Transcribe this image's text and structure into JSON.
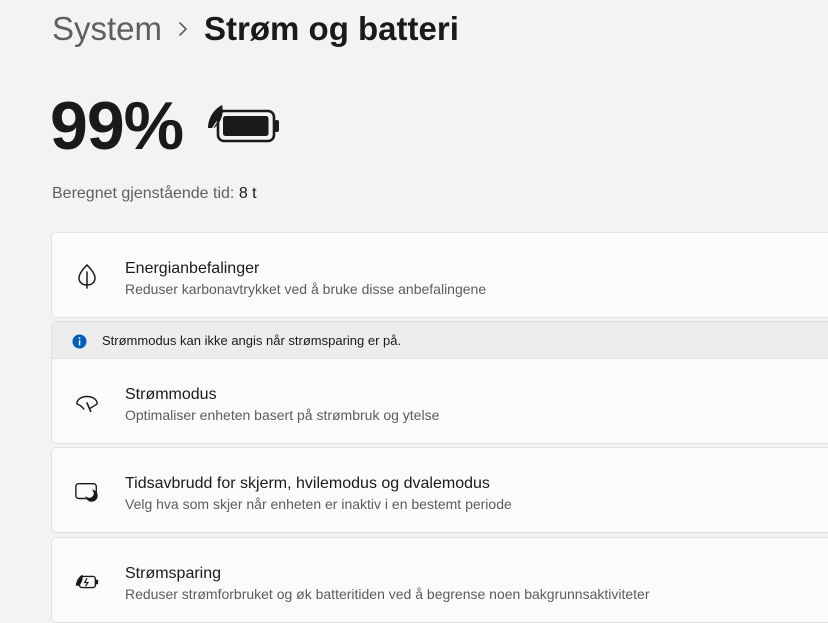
{
  "breadcrumb": {
    "parent": "System",
    "separator_icon": "chevron-right-icon",
    "current": "Strøm og batteri"
  },
  "battery": {
    "percent_label": "99%",
    "level": 0.99,
    "icon": "battery-leaf-icon",
    "remaining_label": "Beregnet gjenstående tid:",
    "remaining_value": "8 t"
  },
  "cards": {
    "recommendations": {
      "icon": "leaf-icon",
      "title": "Energianbefalinger",
      "subtitle": "Reduser karbonavtrykket ved å bruke disse anbefalingene"
    },
    "info_bar": {
      "icon": "info-icon",
      "text": "Strømmodus kan ikke angis når strømsparing er på."
    },
    "power_mode": {
      "icon": "speedometer-icon",
      "title": "Strømmodus",
      "subtitle": "Optimaliser enheten basert på strømbruk og ytelse"
    },
    "timeouts": {
      "icon": "screen-sleep-icon",
      "title": "Tidsavbrudd for skjerm, hvilemodus og dvalemodus",
      "subtitle": "Velg hva som skjer når enheten er inaktiv i en bestemt periode"
    },
    "battery_saver": {
      "icon": "battery-saver-icon",
      "title": "Strømsparing",
      "subtitle": "Reduser strømforbruket og øk batteritiden ved å begrense noen bakgrunnsaktiviteter"
    }
  },
  "colors": {
    "background": "#f3f3f3",
    "card": "#fbfbfb",
    "info_accent": "#005fb8"
  }
}
